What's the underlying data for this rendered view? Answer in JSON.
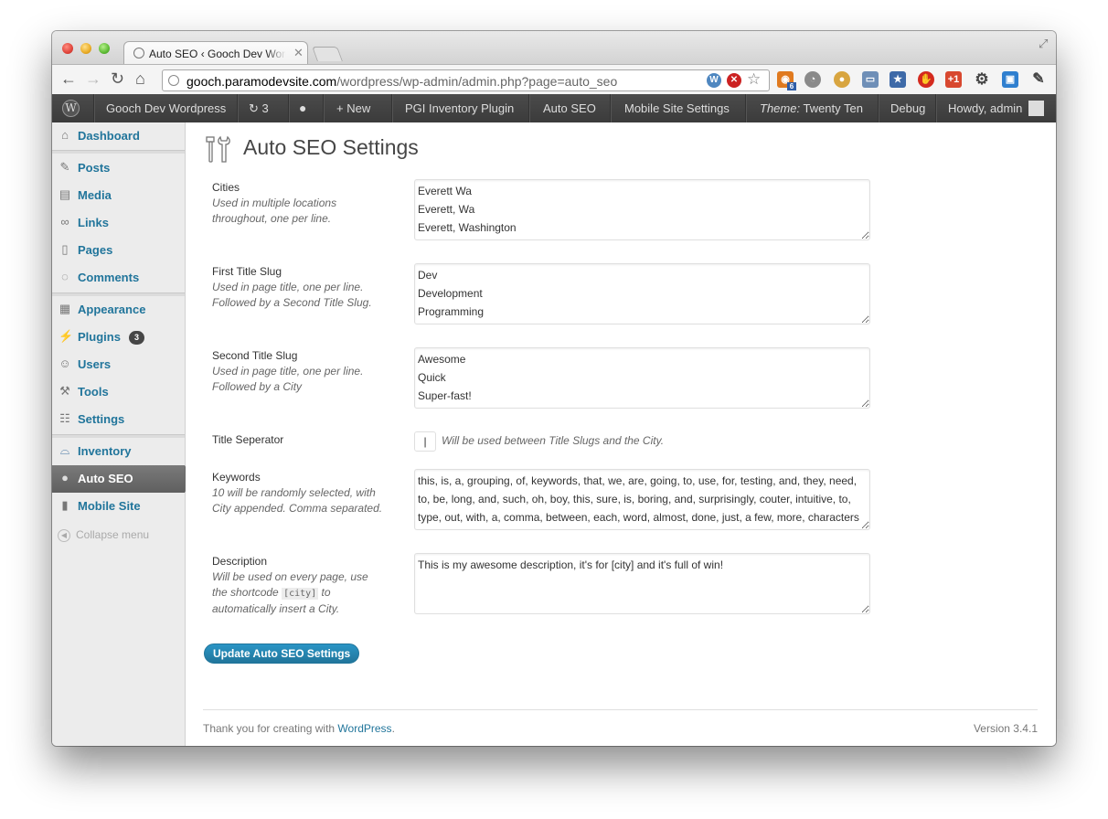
{
  "browser": {
    "tab_title": "Auto SEO ‹ Gooch Dev Wordp",
    "url_host": "gooch.paramodevsite.com",
    "url_path": "/wordpress/wp-admin/admin.php?page=auto_seo",
    "omnibox_icons": [
      "wordpress-icon",
      "blocked-icon",
      "star-icon"
    ],
    "extensions": [
      {
        "name": "rss-extension-icon",
        "color": "#e07a1f",
        "badge": "6"
      },
      {
        "name": "gauge-extension-icon",
        "color": "#8a8a8a"
      },
      {
        "name": "cookie-extension-icon",
        "color": "#d8a540"
      },
      {
        "name": "window-extension-icon",
        "color": "#6f8fb7"
      },
      {
        "name": "bookmark-extension-icon",
        "color": "#3e6aa8"
      },
      {
        "name": "adblock-extension-icon",
        "color": "#d42a1e"
      },
      {
        "name": "google-plus-extension-icon",
        "color": "#d8482f",
        "label": "+1"
      },
      {
        "name": "settings-extension-icon",
        "color": "#444444"
      },
      {
        "name": "screen-extension-icon",
        "color": "#2f7fcf"
      },
      {
        "name": "wrench-icon",
        "color": "#444444"
      }
    ]
  },
  "adminbar": {
    "site_name": "Gooch Dev Wordpress",
    "updates_count": "3",
    "new_label": "New",
    "items": [
      "PGI Inventory Plugin",
      "Auto SEO",
      "Mobile Site Settings"
    ],
    "theme_label": "Theme:",
    "theme_name": "Twenty Ten",
    "debug": "Debug",
    "howdy": "Howdy, admin"
  },
  "sidebar": {
    "items": [
      {
        "label": "Dashboard",
        "icon": "dashboard-icon"
      },
      {
        "label": "Posts",
        "icon": "pin-icon"
      },
      {
        "label": "Media",
        "icon": "media-icon"
      },
      {
        "label": "Links",
        "icon": "link-icon"
      },
      {
        "label": "Pages",
        "icon": "pages-icon"
      },
      {
        "label": "Comments",
        "icon": "comment-icon"
      },
      {
        "label": "Appearance",
        "icon": "appearance-icon"
      },
      {
        "label": "Plugins",
        "icon": "plugin-icon",
        "badge": "3"
      },
      {
        "label": "Users",
        "icon": "users-icon"
      },
      {
        "label": "Tools",
        "icon": "tools-icon"
      },
      {
        "label": "Settings",
        "icon": "settings-icon"
      },
      {
        "label": "Inventory",
        "icon": "car-icon"
      },
      {
        "label": "Auto SEO",
        "icon": "magnifier-icon",
        "active": true
      },
      {
        "label": "Mobile Site",
        "icon": "phone-icon"
      }
    ],
    "collapse": "Collapse menu"
  },
  "main": {
    "title": "Auto SEO Settings",
    "fields": {
      "cities": {
        "label": "Cities",
        "desc": "Used in multiple locations throughout, one per line.",
        "value": "Everett Wa\nEverett, Wa\nEverett, Washington"
      },
      "first_slug": {
        "label": "First Title Slug",
        "desc": "Used in page title, one per line. Followed by a Second Title Slug.",
        "value": "Dev\nDevelopment\nProgramming"
      },
      "second_slug": {
        "label": "Second Title Slug",
        "desc": "Used in page title, one per line. Followed by a City",
        "value": "Awesome\nQuick\nSuper-fast!"
      },
      "separator": {
        "label": "Title Seperator",
        "value": "|",
        "desc": "Will be used between Title Slugs and the City."
      },
      "keywords": {
        "label": "Keywords",
        "desc": "10 will be randomly selected, with City appended. Comma separated.",
        "value": "this, is, a, grouping, of, keywords, that, we, are, going, to, use, for, testing, and, they, need, to, be, long, and, such, oh, boy, this, sure, is, boring, and, surprisingly, couter, intuitive, to, type, out, with, a, comma, between, each, word, almost, done, just, a few, more, characters"
      },
      "description": {
        "label": "Description",
        "desc_before": "Will be used on every page, use the shortcode",
        "desc_code": "[city]",
        "desc_after": "to automatically insert a City.",
        "value": "This is my awesome description, it's for [city] and it's full of win!"
      }
    },
    "submit": "Update Auto SEO Settings"
  },
  "footer": {
    "thanks": "Thank you for creating with",
    "link": "WordPress",
    "period": ".",
    "version": "Version 3.4.1"
  }
}
